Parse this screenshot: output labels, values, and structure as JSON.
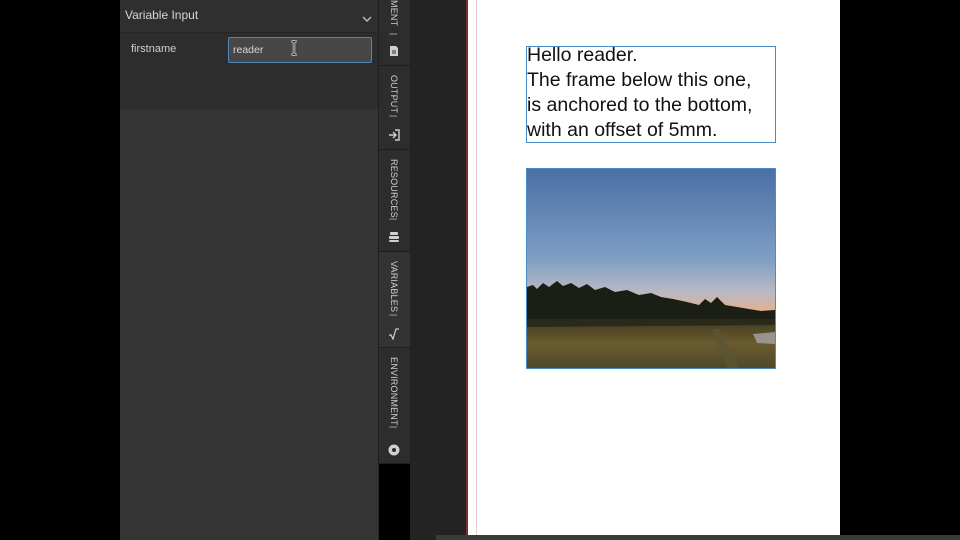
{
  "variable_panel": {
    "title": "Variable Input",
    "variable": {
      "name": "firstname",
      "value": "reader"
    }
  },
  "sidebar_tabs": [
    {
      "label": "MENT",
      "icon": "document-icon"
    },
    {
      "label": "OUTPUT",
      "icon": "sign-in-icon"
    },
    {
      "label": "RESOURCES",
      "icon": "stack-icon"
    },
    {
      "label": "VARIABLES",
      "icon": "square-root-icon",
      "active": true
    },
    {
      "label": "ENVIRONMENT",
      "icon": "settings-icon"
    }
  ],
  "document": {
    "text_lines": [
      "Hello reader.",
      "The frame below this one,",
      "is anchored to the bottom,",
      "with an offset of 5mm."
    ]
  },
  "colors": {
    "frame_border": "#4a8cc8",
    "input_focus": "#4f88b8"
  }
}
